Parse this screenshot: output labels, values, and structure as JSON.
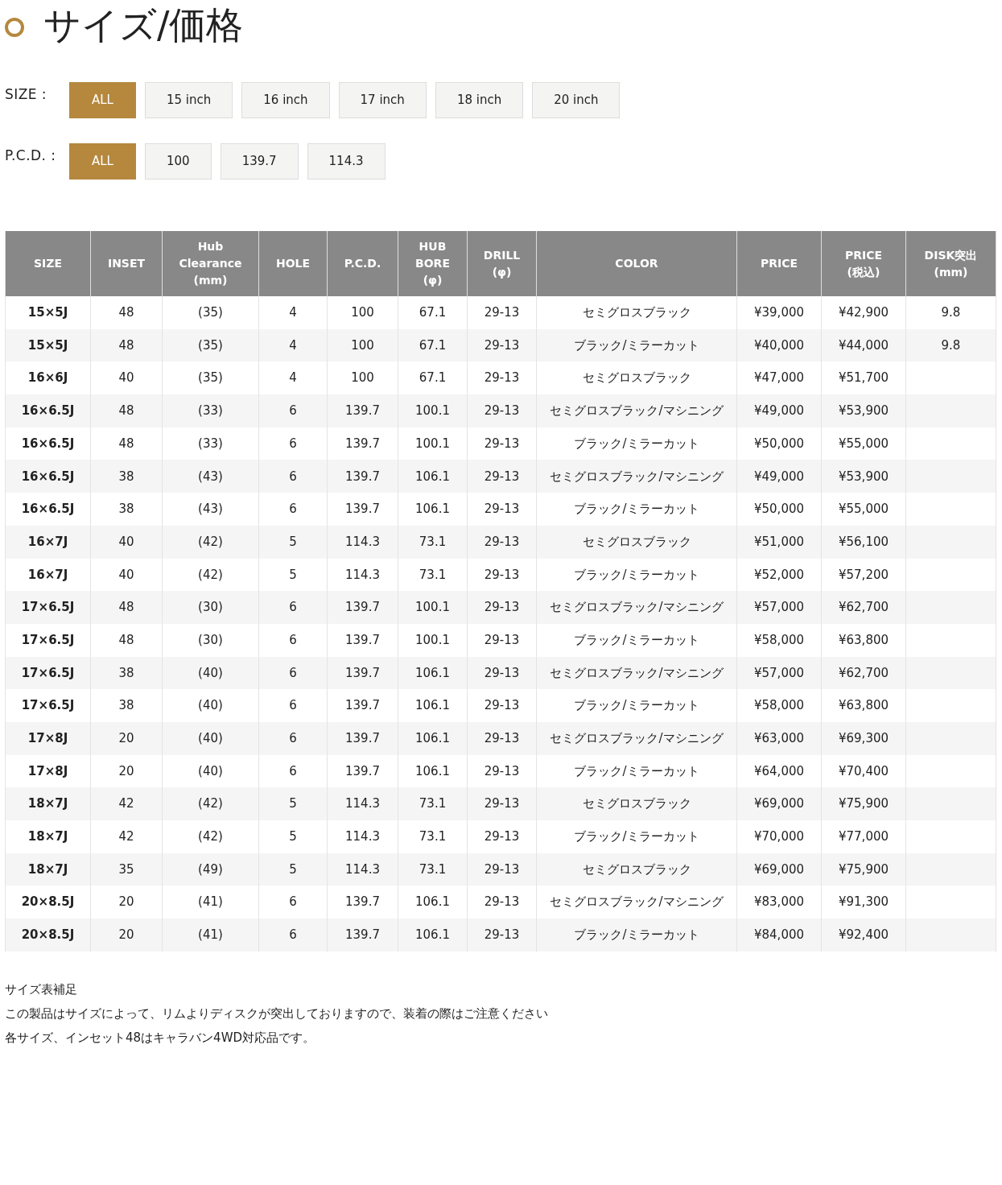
{
  "title": "サイズ/価格",
  "filters": [
    {
      "label": "SIZE :",
      "options": [
        {
          "label": "ALL",
          "selected": true
        },
        {
          "label": "15 inch",
          "selected": false
        },
        {
          "label": "16 inch",
          "selected": false
        },
        {
          "label": "17 inch",
          "selected": false
        },
        {
          "label": "18 inch",
          "selected": false
        },
        {
          "label": "20 inch",
          "selected": false
        }
      ]
    },
    {
      "label": "P.C.D. :",
      "options": [
        {
          "label": "ALL",
          "selected": true
        },
        {
          "label": "100",
          "selected": false
        },
        {
          "label": "139.7",
          "selected": false
        },
        {
          "label": "114.3",
          "selected": false
        }
      ]
    }
  ],
  "table": {
    "columns": [
      "SIZE",
      "INSET",
      "Hub\nClearance\n(mm)",
      "HOLE",
      "P.C.D.",
      "HUB\nBORE\n(φ)",
      "DRILL\n(φ)",
      "COLOR",
      "PRICE",
      "PRICE\n(税込)",
      "DISK突出\n(mm)"
    ],
    "rows": [
      [
        "15×5J",
        "48",
        "(35)",
        "4",
        "100",
        "67.1",
        "29-13",
        "セミグロスブラック",
        "¥39,000",
        "¥42,900",
        "9.8"
      ],
      [
        "15×5J",
        "48",
        "(35)",
        "4",
        "100",
        "67.1",
        "29-13",
        "ブラック/ミラーカット",
        "¥40,000",
        "¥44,000",
        "9.8"
      ],
      [
        "16×6J",
        "40",
        "(35)",
        "4",
        "100",
        "67.1",
        "29-13",
        "セミグロスブラック",
        "¥47,000",
        "¥51,700",
        ""
      ],
      [
        "16×6.5J",
        "48",
        "(33)",
        "6",
        "139.7",
        "100.1",
        "29-13",
        "セミグロスブラック/マシニング",
        "¥49,000",
        "¥53,900",
        ""
      ],
      [
        "16×6.5J",
        "48",
        "(33)",
        "6",
        "139.7",
        "100.1",
        "29-13",
        "ブラック/ミラーカット",
        "¥50,000",
        "¥55,000",
        ""
      ],
      [
        "16×6.5J",
        "38",
        "(43)",
        "6",
        "139.7",
        "106.1",
        "29-13",
        "セミグロスブラック/マシニング",
        "¥49,000",
        "¥53,900",
        ""
      ],
      [
        "16×6.5J",
        "38",
        "(43)",
        "6",
        "139.7",
        "106.1",
        "29-13",
        "ブラック/ミラーカット",
        "¥50,000",
        "¥55,000",
        ""
      ],
      [
        "16×7J",
        "40",
        "(42)",
        "5",
        "114.3",
        "73.1",
        "29-13",
        "セミグロスブラック",
        "¥51,000",
        "¥56,100",
        ""
      ],
      [
        "16×7J",
        "40",
        "(42)",
        "5",
        "114.3",
        "73.1",
        "29-13",
        "ブラック/ミラーカット",
        "¥52,000",
        "¥57,200",
        ""
      ],
      [
        "17×6.5J",
        "48",
        "(30)",
        "6",
        "139.7",
        "100.1",
        "29-13",
        "セミグロスブラック/マシニング",
        "¥57,000",
        "¥62,700",
        ""
      ],
      [
        "17×6.5J",
        "48",
        "(30)",
        "6",
        "139.7",
        "100.1",
        "29-13",
        "ブラック/ミラーカット",
        "¥58,000",
        "¥63,800",
        ""
      ],
      [
        "17×6.5J",
        "38",
        "(40)",
        "6",
        "139.7",
        "106.1",
        "29-13",
        "セミグロスブラック/マシニング",
        "¥57,000",
        "¥62,700",
        ""
      ],
      [
        "17×6.5J",
        "38",
        "(40)",
        "6",
        "139.7",
        "106.1",
        "29-13",
        "ブラック/ミラーカット",
        "¥58,000",
        "¥63,800",
        ""
      ],
      [
        "17×8J",
        "20",
        "(40)",
        "6",
        "139.7",
        "106.1",
        "29-13",
        "セミグロスブラック/マシニング",
        "¥63,000",
        "¥69,300",
        ""
      ],
      [
        "17×8J",
        "20",
        "(40)",
        "6",
        "139.7",
        "106.1",
        "29-13",
        "ブラック/ミラーカット",
        "¥64,000",
        "¥70,400",
        ""
      ],
      [
        "18×7J",
        "42",
        "(42)",
        "5",
        "114.3",
        "73.1",
        "29-13",
        "セミグロスブラック",
        "¥69,000",
        "¥75,900",
        ""
      ],
      [
        "18×7J",
        "42",
        "(42)",
        "5",
        "114.3",
        "73.1",
        "29-13",
        "ブラック/ミラーカット",
        "¥70,000",
        "¥77,000",
        ""
      ],
      [
        "18×7J",
        "35",
        "(49)",
        "5",
        "114.3",
        "73.1",
        "29-13",
        "セミグロスブラック",
        "¥69,000",
        "¥75,900",
        ""
      ],
      [
        "20×8.5J",
        "20",
        "(41)",
        "6",
        "139.7",
        "106.1",
        "29-13",
        "セミグロスブラック/マシニング",
        "¥83,000",
        "¥91,300",
        ""
      ],
      [
        "20×8.5J",
        "20",
        "(41)",
        "6",
        "139.7",
        "106.1",
        "29-13",
        "ブラック/ミラーカット",
        "¥84,000",
        "¥92,400",
        ""
      ]
    ]
  },
  "notes": [
    "サイズ表補足",
    "この製品はサイズによって、リムよりディスクが突出しておりますので、装着の際はご注意ください",
    "各サイズ、インセット48はキャラバン4WD対応品です。"
  ]
}
